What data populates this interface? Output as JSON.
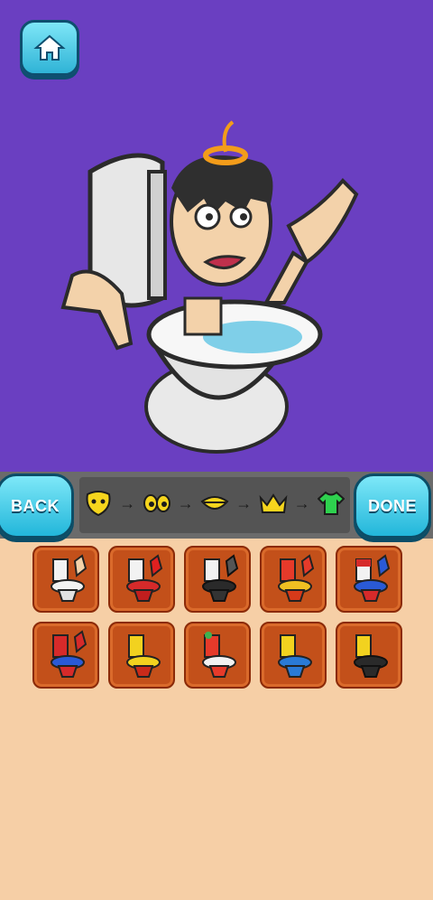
{
  "buttons": {
    "back_label": "BACK",
    "done_label": "DONE"
  },
  "toolbar": {
    "steps": [
      "face-shape-icon",
      "eyes-icon",
      "mouth-icon",
      "crown-icon",
      "shirt-icon"
    ]
  },
  "colors": {
    "background_canvas": "#6a3fc1",
    "toolbar": "#6b6b6b",
    "tile": "#c3501a",
    "button": "#2fb3d6",
    "panel_bg": "#f6cfa6"
  },
  "grid": {
    "tiles": [
      {
        "icon": "white-toilet-icon"
      },
      {
        "icon": "red-toilet-icon"
      },
      {
        "icon": "black-toilet-icon"
      },
      {
        "icon": "gold-red-toilet-icon"
      },
      {
        "icon": "flag-toilet-icon"
      },
      {
        "icon": "spider-toilet-icon"
      },
      {
        "icon": "yellow-toilet-icon"
      },
      {
        "icon": "red-white-toilet-icon"
      },
      {
        "icon": "blue-toilet-icon"
      },
      {
        "icon": "black-gold-toilet-icon"
      }
    ]
  }
}
